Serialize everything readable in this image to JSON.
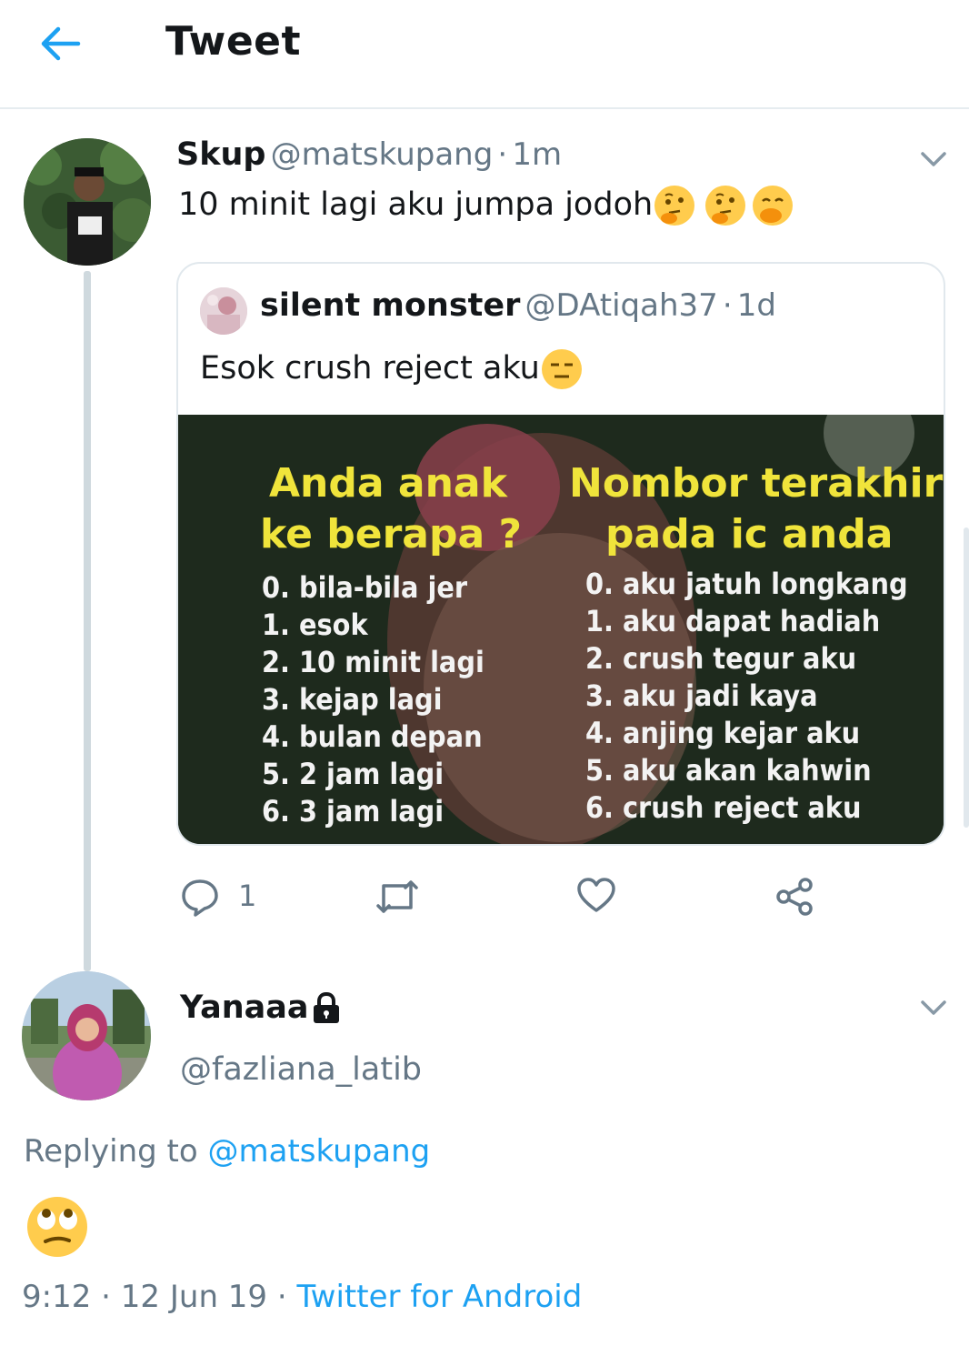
{
  "header": {
    "title": "Tweet"
  },
  "tweet": {
    "name": "Skup",
    "handle": "@matskupang",
    "separator": "·",
    "time": "1m",
    "text": "10 minit lagi aku jumpa jodoh",
    "emoji": [
      "thinking-face",
      "thinking-face",
      "face-with-hand-over-mouth"
    ],
    "quote": {
      "name": "silent monster",
      "handle": "@DAtiqah37",
      "separator": "·",
      "time": "1d",
      "text": "Esok crush reject aku",
      "emoji": "expressionless-face",
      "image": {
        "left_title_1": "Anda anak",
        "left_title_2": "ke berapa ?",
        "right_title_1": "Nombor terakhir",
        "right_title_2": "pada ic anda",
        "left_items": [
          "0. bila-bila jer",
          "1. esok",
          "2. 10 minit lagi",
          "3. kejap lagi",
          "4. bulan depan",
          "5. 2 jam lagi",
          "6. 3 jam lagi"
        ],
        "right_items": [
          "0. aku jatuh longkang",
          "1. aku dapat hadiah",
          "2. crush tegur aku",
          "3. aku jadi kaya",
          "4. anjing kejar aku",
          "5. aku akan kahwin",
          "6. crush reject aku"
        ]
      }
    },
    "actions": {
      "reply_count": "1"
    }
  },
  "reply": {
    "name": "Yanaaa",
    "handle": "@fazliana_latib",
    "replying_label": "Replying to",
    "replying_to": "@matskupang",
    "emoji": "face-with-rolling-eyes",
    "time": "9:12",
    "sep1": "·",
    "date": "12 Jun 19",
    "sep2": "·",
    "source": "Twitter for Android"
  },
  "colors": {
    "accent": "#1da1f2",
    "text": "#14171a",
    "secondary": "#657786",
    "border": "#e1e8ed",
    "emoji_yellow": "#ffcc4d"
  }
}
